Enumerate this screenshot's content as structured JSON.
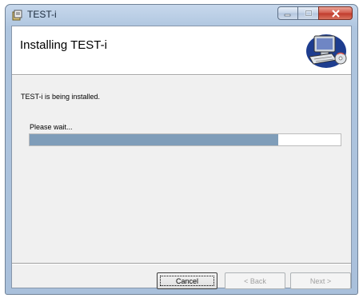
{
  "window": {
    "title": "TEST-i"
  },
  "banner": {
    "title": "Installing TEST-i"
  },
  "body": {
    "status": "TEST-i is being installed.",
    "wait": "Please wait..."
  },
  "progress": {
    "value_percent": 80
  },
  "buttons": {
    "cancel": "Cancel",
    "back": "< Back",
    "next": "Next >"
  },
  "colors": {
    "progress_fill": "#7f9db9",
    "close_button": "#c0392b"
  },
  "icons": {
    "app": "installer-icon",
    "banner": "computer-install-icon"
  }
}
